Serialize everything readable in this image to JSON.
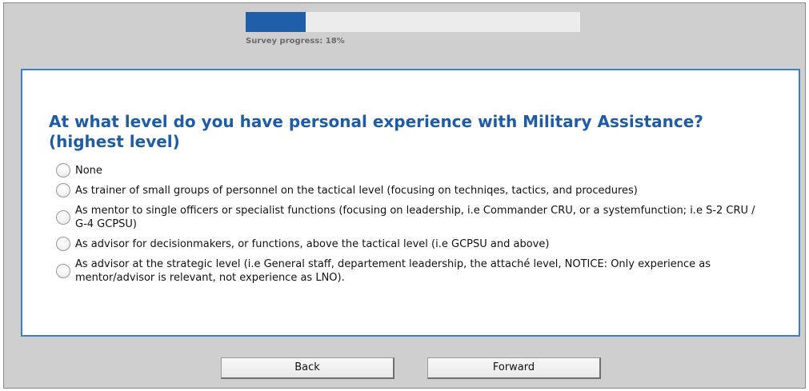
{
  "progress": {
    "label": "Survey progress: 18%",
    "fraction": 0.18,
    "color": "#1f5ea8"
  },
  "question": {
    "text": "At what level do you have personal experience with Military Assistance? (highest level)",
    "color": "#1e5da6"
  },
  "options": [
    {
      "label": "None",
      "selected": false
    },
    {
      "label": "As trainer of small groups of personnel on the tactical level (focusing on techniqes, tactics, and procedures)",
      "selected": false
    },
    {
      "label": "As mentor to single officers or specialist functions (focusing on leadership, i.e Commander CRU, or a systemfunction; i.e S-2 CRU / G-4 GCPSU)",
      "selected": false
    },
    {
      "label": "As advisor for decisionmakers, or functions, above the tactical level (i.e GCPSU and above)",
      "selected": false
    },
    {
      "label": "As advisor at the strategic level (i.e General staff, departement leadership, the attaché level, NOTICE: Only experience as mentor/advisor is relevant, not  experience as LNO).",
      "selected": false
    }
  ],
  "nav": {
    "back_label": "Back",
    "forward_label": "Forward"
  }
}
